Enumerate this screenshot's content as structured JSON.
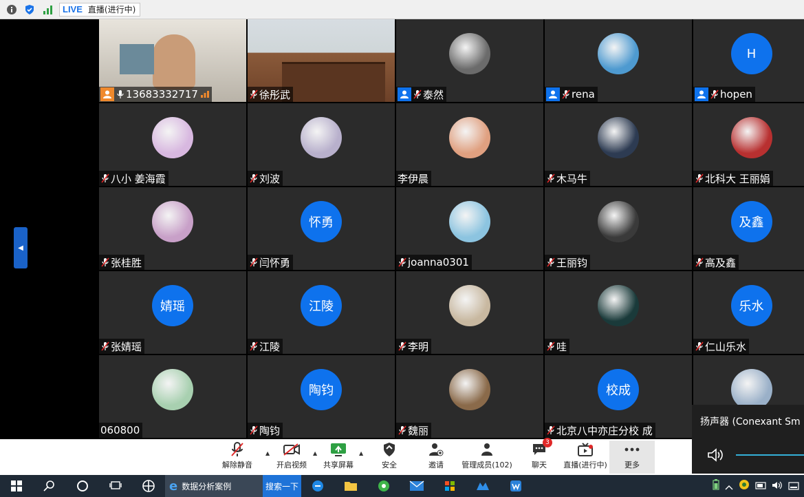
{
  "topbar": {
    "live_tag": "LIVE",
    "live_status": "直播(进行中)"
  },
  "participants": [
    {
      "name": "13683332717",
      "kind": "video-host",
      "badge": "host",
      "mic": "on"
    },
    {
      "name": "徐彤武",
      "kind": "video-room",
      "badge": "",
      "mic": "muted"
    },
    {
      "name": "泰然",
      "kind": "photo",
      "badge": "user",
      "mic": "muted",
      "color": "#6b6b6b"
    },
    {
      "name": "rena",
      "kind": "photo",
      "badge": "user",
      "mic": "muted",
      "color": "#4e9ad0"
    },
    {
      "name": "hopen",
      "kind": "text",
      "avatar_text": "H",
      "badge": "user",
      "mic": "muted"
    },
    {
      "name": "八小 姜海霞",
      "kind": "photo",
      "badge": "",
      "mic": "muted",
      "color": "#d8b8e0"
    },
    {
      "name": "刘波",
      "kind": "photo",
      "badge": "",
      "mic": "muted",
      "color": "#b8b0cc"
    },
    {
      "name": "李伊晨",
      "kind": "photo",
      "badge": "",
      "mic": "none",
      "color": "#e0a080"
    },
    {
      "name": "木马牛",
      "kind": "photo",
      "badge": "",
      "mic": "muted",
      "color": "#2d3b52"
    },
    {
      "name": "北科大 王丽娟",
      "kind": "photo",
      "badge": "",
      "mic": "muted",
      "color": "#b83030"
    },
    {
      "name": "张桂胜",
      "kind": "photo",
      "badge": "",
      "mic": "muted",
      "color": "#c8a0c8"
    },
    {
      "name": "闫怀勇",
      "kind": "text",
      "avatar_text": "怀勇",
      "badge": "",
      "mic": "muted"
    },
    {
      "name": "joanna0301",
      "kind": "photo",
      "badge": "",
      "mic": "muted",
      "color": "#8cc4e0"
    },
    {
      "name": "王丽钧",
      "kind": "photo",
      "badge": "",
      "mic": "muted",
      "color": "#3a3a3a"
    },
    {
      "name": "高及鑫",
      "kind": "text",
      "avatar_text": "及鑫",
      "badge": "",
      "mic": "muted"
    },
    {
      "name": "张婧瑶",
      "kind": "text",
      "avatar_text": "婧瑶",
      "badge": "",
      "mic": "muted"
    },
    {
      "name": "江陵",
      "kind": "text",
      "avatar_text": "江陵",
      "badge": "",
      "mic": "muted"
    },
    {
      "name": "李明",
      "kind": "photo",
      "badge": "",
      "mic": "muted",
      "color": "#c8b8a0"
    },
    {
      "name": "哇",
      "kind": "photo",
      "badge": "",
      "mic": "muted",
      "color": "#1a3a3a"
    },
    {
      "name": "仁山乐水",
      "kind": "text",
      "avatar_text": "乐水",
      "badge": "",
      "mic": "muted"
    },
    {
      "name": "060800",
      "kind": "photo",
      "badge": "",
      "mic": "none",
      "color": "#a8d0b0"
    },
    {
      "name": "陶钧",
      "kind": "text",
      "avatar_text": "陶钧",
      "badge": "",
      "mic": "muted"
    },
    {
      "name": "魏丽",
      "kind": "photo",
      "badge": "",
      "mic": "muted",
      "color": "#8a6a4a"
    },
    {
      "name": "北京八中亦庄分校 成",
      "kind": "text",
      "avatar_text": "校成",
      "badge": "",
      "mic": "muted"
    },
    {
      "name": "",
      "kind": "photo",
      "badge": "",
      "mic": "none",
      "color": "#9ab0c8"
    }
  ],
  "toolbar": {
    "mute_label": "解除静音",
    "video_label": "开启视频",
    "share_label": "共享屏幕",
    "security_label": "安全",
    "invite_label": "邀请",
    "participants_label": "管理成员(102)",
    "chat_label": "聊天",
    "chat_badge": "3",
    "live_label": "直播(进行中)",
    "more_label": "更多"
  },
  "speaker_popup": {
    "label": "扬声器 (Conexant Sm"
  },
  "taskbar": {
    "ie_title": "数据分析案例",
    "search_button": "搜索一下"
  },
  "colors": {
    "accent": "#0e72ed",
    "host": "#f0892c",
    "tile_bg": "#2b2b2b"
  }
}
